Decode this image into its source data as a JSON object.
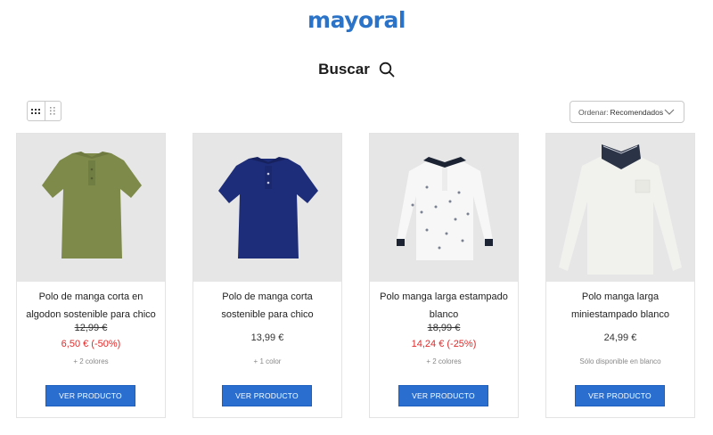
{
  "brand": {
    "logo_text": "mayoral",
    "accent": "#2a73c8"
  },
  "search": {
    "label": "Buscar",
    "icon": "search-icon"
  },
  "view_toggle": {
    "options": [
      "grid-large-icon",
      "grid-small-icon"
    ]
  },
  "sort": {
    "label": "Ordenar:",
    "value": "Recomendados",
    "icon": "chevron-down-icon"
  },
  "products": [
    {
      "name": "Polo de manga corta en algodon sostenible para chico",
      "old_price": "12,99 €",
      "sale_price": "6,50 € (-50%)",
      "note": "+ 2 colores",
      "button": "VER PRODUCTO",
      "image": "olive-polo-short-sleeve"
    },
    {
      "name": "Polo de manga corta sostenible para chico",
      "price": "13,99 €",
      "note": "+ 1 color",
      "button": "VER PRODUCTO",
      "image": "navy-polo-short-sleeve"
    },
    {
      "name": "Polo manga larga estampado blanco",
      "old_price": "18,99 €",
      "sale_price": "14,24 € (-25%)",
      "note": "+ 2 colores",
      "button": "VER PRODUCTO",
      "image": "white-printed-polo-long-sleeve"
    },
    {
      "name": "Polo manga larga miniestampado blanco",
      "price": "24,99 €",
      "note": "Sólo disponible en blanco",
      "button": "VER PRODUCTO",
      "image": "white-polo-long-sleeve"
    }
  ],
  "colors": {
    "button": "#2a6fd0",
    "sale": "#e02a2a"
  }
}
